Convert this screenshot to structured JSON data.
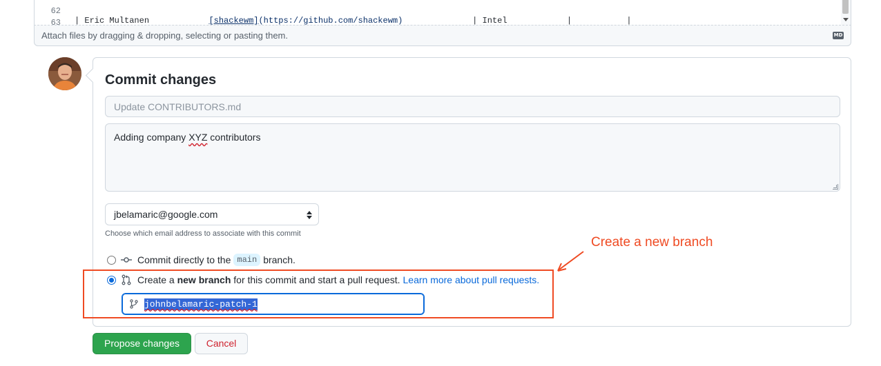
{
  "editor": {
    "lines": [
      {
        "num": "62",
        "name": "| Eric Multanen",
        "link_text": "[shackewm]",
        "link_url": "(https://github.com/shackewm)",
        "company": "| Intel",
        "rest": "|           |"
      },
      {
        "num": "63"
      }
    ],
    "attach_hint": "Attach files by dragging & dropping, selecting or pasting them.",
    "markdown_badge": "MD"
  },
  "commit": {
    "title": "Commit changes",
    "summary_placeholder": "Update CONTRIBUTORS.md",
    "description_before": "Adding company ",
    "description_misspelled": "XYZ",
    "description_after": " contributors",
    "email_selected": "jbelamaric@google.com",
    "email_note": "Choose which email address to associate with this commit",
    "option_direct": {
      "before": "Commit directly to the",
      "branch": "main",
      "after": "branch.",
      "checked": false
    },
    "option_new_branch": {
      "before": "Create a ",
      "bold": "new branch",
      "after": " for this commit and start a pull request.",
      "link": "Learn more about pull requests.",
      "checked": true
    },
    "branch_name": "johnbelamaric-patch-1"
  },
  "buttons": {
    "propose": "Propose changes",
    "cancel": "Cancel"
  },
  "annotation": {
    "label": "Create a new branch",
    "color": "#ef4a22"
  },
  "colors": {
    "accent": "#0969da",
    "propose_green": "#2da44e",
    "cancel_red": "#cf222e"
  }
}
